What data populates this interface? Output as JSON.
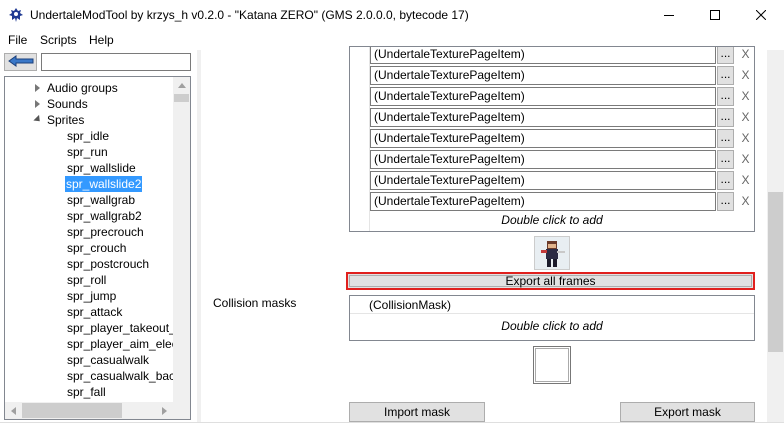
{
  "window": {
    "title": "UndertaleModTool by krzys_h v0.2.0 - \"Katana ZERO\" (GMS 2.0.0.0, bytecode 17)",
    "icon": "skull-app-icon",
    "minimize_icon": "minimize-icon",
    "maximize_icon": "maximize-icon",
    "close_icon": "close-icon"
  },
  "menu": [
    "File",
    "Scripts",
    "Help"
  ],
  "tree": {
    "search_value": "",
    "items": [
      {
        "label": "Audio groups",
        "level": 1,
        "expander": "collapsed"
      },
      {
        "label": "Sounds",
        "level": 1,
        "expander": "collapsed"
      },
      {
        "label": "Sprites",
        "level": 1,
        "expander": "expanded"
      },
      {
        "label": "spr_idle",
        "level": 2
      },
      {
        "label": "spr_run",
        "level": 2
      },
      {
        "label": "spr_wallslide",
        "level": 2
      },
      {
        "label": "spr_wallslide2",
        "level": 2,
        "selected": true
      },
      {
        "label": "spr_wallgrab",
        "level": 2
      },
      {
        "label": "spr_wallgrab2",
        "level": 2
      },
      {
        "label": "spr_precrouch",
        "level": 2
      },
      {
        "label": "spr_crouch",
        "level": 2
      },
      {
        "label": "spr_postcrouch",
        "level": 2
      },
      {
        "label": "spr_roll",
        "level": 2
      },
      {
        "label": "spr_jump",
        "level": 2
      },
      {
        "label": "spr_attack",
        "level": 2
      },
      {
        "label": "spr_player_takeout_e",
        "level": 2
      },
      {
        "label": "spr_player_aim_elect",
        "level": 2
      },
      {
        "label": "spr_casualwalk",
        "level": 2
      },
      {
        "label": "spr_casualwalk_back",
        "level": 2
      },
      {
        "label": "spr_fall",
        "level": 2
      }
    ]
  },
  "textures": {
    "items": [
      "(UndertaleTexturePageItem)",
      "(UndertaleTexturePageItem)",
      "(UndertaleTexturePageItem)",
      "(UndertaleTexturePageItem)",
      "(UndertaleTexturePageItem)",
      "(UndertaleTexturePageItem)",
      "(UndertaleTexturePageItem)",
      "(UndertaleTexturePageItem)"
    ],
    "pick_label": "...",
    "remove_label": "X",
    "add_hint": "Double click to add"
  },
  "export_frames_label": "Export all frames",
  "collision": {
    "label": "Collision masks",
    "items": [
      "(CollisionMask)"
    ],
    "add_hint": "Double click to add"
  },
  "import_mask_label": "Import mask",
  "export_mask_label": "Export mask",
  "colors": {
    "selection": "#3399ff",
    "highlight_border": "#e0201d",
    "button_face": "#e1e1e1"
  }
}
